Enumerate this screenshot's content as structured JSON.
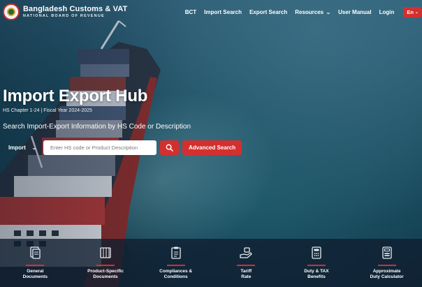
{
  "header": {
    "brand_title": "Bangladesh Customs & VAT",
    "brand_subtitle": "NATIONAL BOARD OF REVENUE",
    "nav": [
      {
        "label": "BCT"
      },
      {
        "label": "Import Search"
      },
      {
        "label": "Export Search"
      },
      {
        "label": "Resources"
      },
      {
        "label": "User Manual"
      },
      {
        "label": "Login"
      }
    ],
    "language": "En"
  },
  "hero": {
    "title": "Import Export Hub",
    "meta": "HS Chapter 1-24 | Fiscal Year 2024-2025",
    "lead": "Search Import-Export Information by HS Code or Description",
    "search": {
      "type_value": "Import",
      "placeholder": "Enter HS code or Product Description",
      "advanced_label": "Advanced Search"
    }
  },
  "categories": [
    {
      "label": "General\nDocuments",
      "icon": "document-stack-icon"
    },
    {
      "label": "Product-Specific\nDocuments",
      "icon": "product-document-icon"
    },
    {
      "label": "Compliances &\nConditions",
      "icon": "clipboard-icon"
    },
    {
      "label": "Tariff\nRate",
      "icon": "tariff-hand-icon"
    },
    {
      "label": "Duty & TAX\nBenefits",
      "icon": "calculator-doc-icon"
    },
    {
      "label": "Approximate\nDuty Calculator",
      "icon": "calculator-icon"
    }
  ],
  "colors": {
    "accent": "#d42f2f",
    "sea": "#1d4e63"
  }
}
